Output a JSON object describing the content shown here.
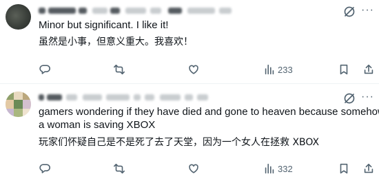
{
  "colors": {
    "text": "#0f1419",
    "muted": "#536471",
    "divider": "#eff3f4",
    "background": "#ffffff"
  },
  "posts": [
    {
      "author_redacted": true,
      "text_en": "Minor but significant. I like it!",
      "text_zh": "虽然是小事，但意义重大。我喜欢！",
      "stats": {
        "views": "233"
      },
      "icons": [
        "reply-icon",
        "repost-icon",
        "like-icon",
        "views-icon",
        "bookmark-icon",
        "share-icon",
        "grok-icon",
        "more-icon"
      ]
    },
    {
      "author_redacted": true,
      "text_en_line1": "gamers wondering if they have died and gone to heaven because somehow",
      "text_en_line2": "a woman is saving XBOX",
      "text_zh": "玩家们怀疑自己是不是死了去了天堂，因为一个女人在拯救 XBOX",
      "stats": {
        "views": "332"
      },
      "icons": [
        "reply-icon",
        "repost-icon",
        "like-icon",
        "views-icon",
        "bookmark-icon",
        "share-icon",
        "grok-icon",
        "more-icon"
      ]
    }
  ]
}
